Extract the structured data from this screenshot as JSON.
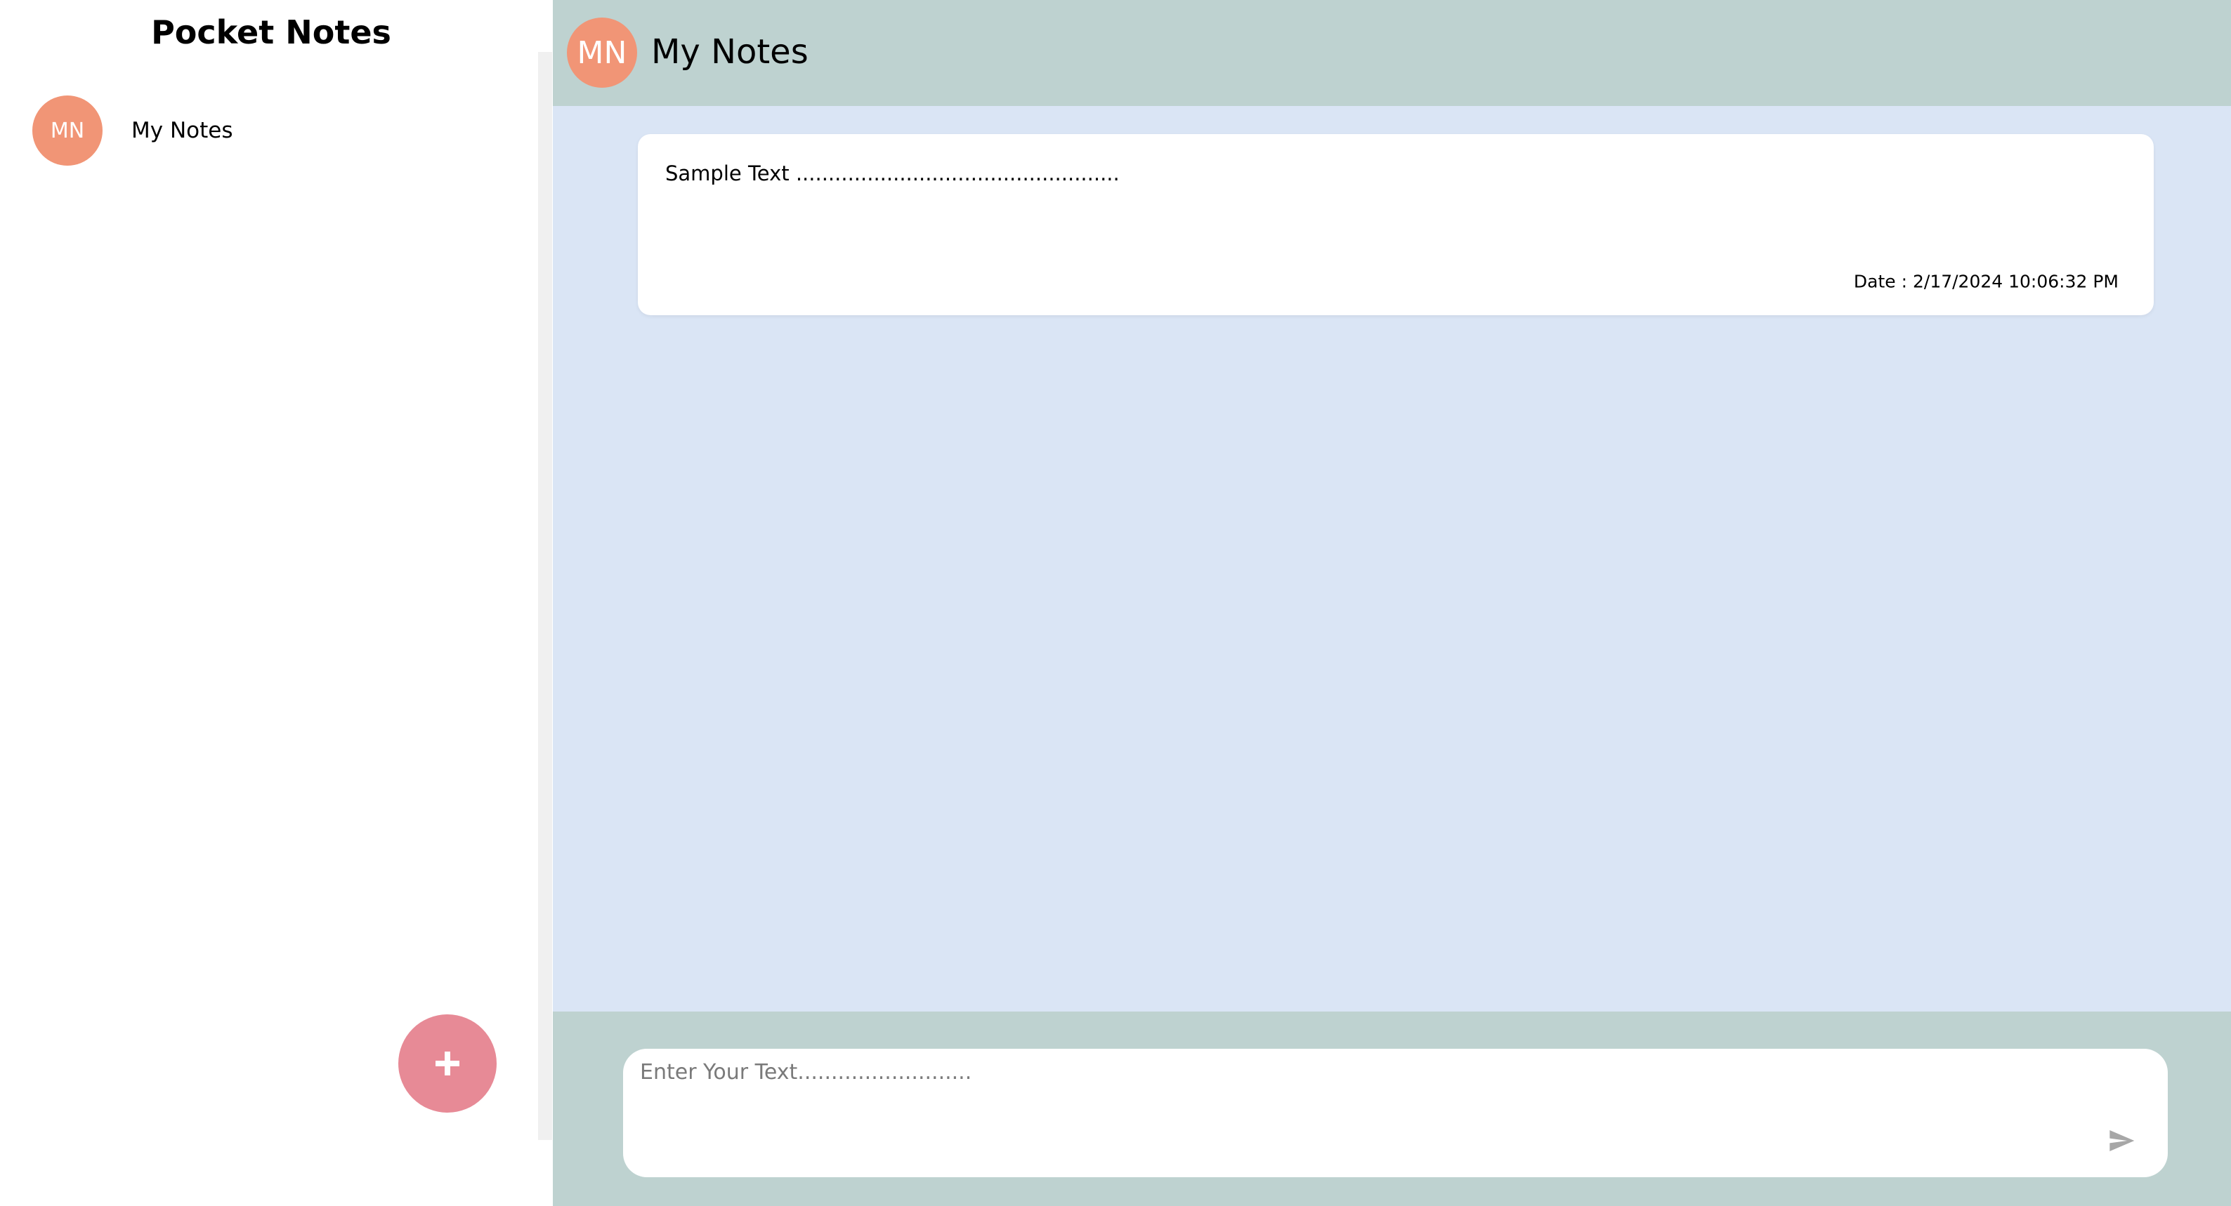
{
  "sidebar": {
    "title": "Pocket Notes",
    "groups": [
      {
        "initials": "MN",
        "name": "My Notes",
        "color": "#F19576"
      }
    ],
    "add_button": {
      "label": "+",
      "icon": "plus-icon",
      "color": "#E78A96"
    }
  },
  "main": {
    "header": {
      "initials": "MN",
      "title": "My Notes",
      "background": "#BED2D0"
    },
    "notes": [
      {
        "text": "Sample Text ..................................................",
        "date": "Date : 2/17/2024 10:06:32 PM"
      }
    ],
    "composer": {
      "placeholder": "Enter Your Text..........................",
      "value": "",
      "send_icon": "send-icon"
    },
    "background": "#DAE5F5"
  },
  "colors": {
    "avatar": "#F19576",
    "add_button": "#E78A96",
    "header_footer": "#BED2D0",
    "notes_background": "#DAE5F5",
    "send_icon": "#A7A7A7"
  }
}
